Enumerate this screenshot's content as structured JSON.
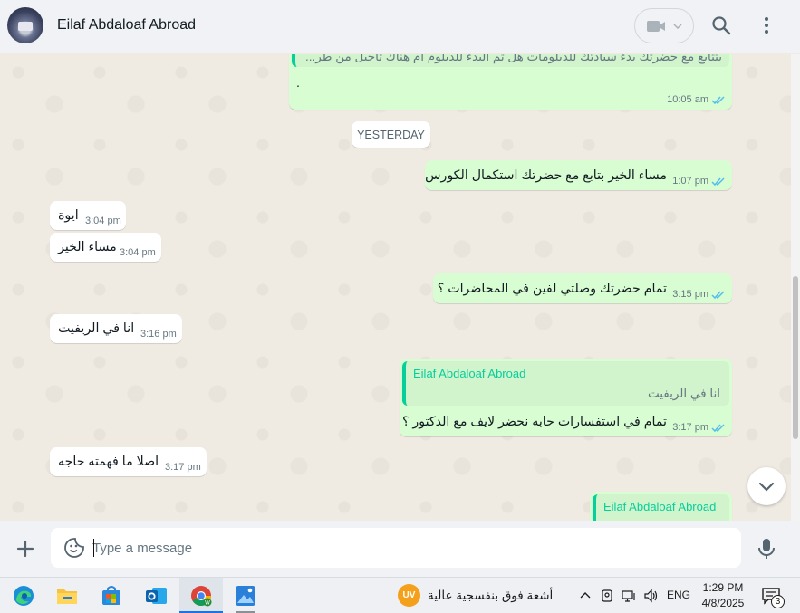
{
  "header": {
    "contact_name": "Eilaf Abdaloaf Abroad"
  },
  "messages": [
    {
      "id": "m0",
      "dir": "out",
      "quote_text": "بتتابع مع حضرتك بدء سيادتك للدبلومات هل تم البدء للدبلوم أم هناك تأجيل من طر...",
      "text": ".",
      "time": "10:05 am"
    },
    {
      "id": "day",
      "day_label": "YESTERDAY"
    },
    {
      "id": "m1",
      "dir": "out",
      "text": "مساء الخير بتابع مع حضرتك استكمال الكورس",
      "time": "1:07 pm"
    },
    {
      "id": "m2",
      "dir": "in",
      "text": "ايوة",
      "time": "3:04 pm"
    },
    {
      "id": "m3",
      "dir": "in",
      "text": "مساء الخير",
      "time": "3:04 pm"
    },
    {
      "id": "m4",
      "dir": "out",
      "text": "تمام حضرتك وصلتي لفين في المحاضرات ؟",
      "time": "3:15 pm"
    },
    {
      "id": "m5",
      "dir": "in",
      "text": "انا في الريفيت",
      "time": "3:16 pm"
    },
    {
      "id": "m6",
      "dir": "out",
      "quote_name": "Eilaf Abdaloaf Abroad",
      "quote_text": "انا في الريفيت",
      "text": "تمام في استفسارات حابه نحضر لايف مع الدكتور ؟",
      "time": "3:17 pm"
    },
    {
      "id": "m7",
      "dir": "in",
      "text": "اصلا ما فهمته حاجه",
      "time": "3:17 pm"
    },
    {
      "id": "m8",
      "dir": "out",
      "quote_name": "Eilaf Abdaloaf Abroad"
    }
  ],
  "composer": {
    "placeholder": "Type a message"
  },
  "taskbar": {
    "apps": [
      "edge-icon",
      "file-explorer-icon",
      "store-icon",
      "outlook-icon",
      "chrome-icon",
      "photos-icon"
    ],
    "weather_badge": "UV",
    "weather_text": "أشعة فوق بنفسجية عالية",
    "language": "ENG",
    "time": "1:29 PM",
    "date": "4/8/2025",
    "notification_count": "3"
  },
  "colors": {
    "outgoing_bubble": "#d9fdd3",
    "incoming_bubble": "#ffffff",
    "read_ticks": "#53bdeb",
    "quote_accent": "#06cf9c",
    "chat_background": "#efeae2"
  }
}
